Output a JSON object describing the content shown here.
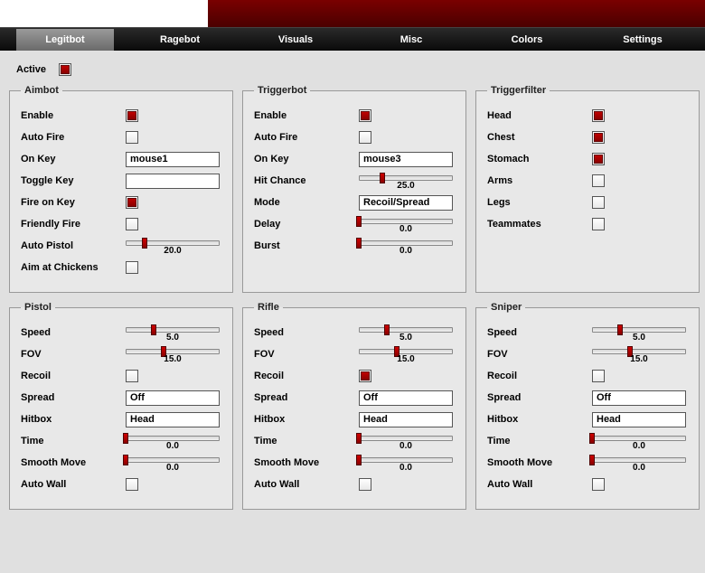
{
  "tabs": [
    "Legitbot",
    "Ragebot",
    "Visuals",
    "Misc",
    "Colors",
    "Settings"
  ],
  "active_tab": "Legitbot",
  "top": {
    "active_label": "Active",
    "active_checked": true
  },
  "panels": {
    "aimbot": {
      "title": "Aimbot",
      "enable_label": "Enable",
      "enable_checked": true,
      "autofire_label": "Auto Fire",
      "autofire_checked": false,
      "onkey_label": "On Key",
      "onkey_value": "mouse1",
      "togglekey_label": "Toggle Key",
      "togglekey_value": "",
      "fireonkey_label": "Fire on Key",
      "fireonkey_checked": true,
      "friendlyfire_label": "Friendly Fire",
      "friendlyfire_checked": false,
      "autopistol_label": "Auto Pistol",
      "autopistol_value": "20.0",
      "autopistol_pct": 20,
      "aimchickens_label": "Aim at Chickens",
      "aimchickens_checked": false
    },
    "triggerbot": {
      "title": "Triggerbot",
      "enable_label": "Enable",
      "enable_checked": true,
      "autofire_label": "Auto Fire",
      "autofire_checked": false,
      "onkey_label": "On Key",
      "onkey_value": "mouse3",
      "hitchance_label": "Hit Chance",
      "hitchance_value": "25.0",
      "hitchance_pct": 25,
      "mode_label": "Mode",
      "mode_value": "Recoil/Spread",
      "delay_label": "Delay",
      "delay_value": "0.0",
      "delay_pct": 0,
      "burst_label": "Burst",
      "burst_value": "0.0",
      "burst_pct": 0
    },
    "triggerfilter": {
      "title": "Triggerfilter",
      "head_label": "Head",
      "head_checked": true,
      "chest_label": "Chest",
      "chest_checked": true,
      "stomach_label": "Stomach",
      "stomach_checked": true,
      "arms_label": "Arms",
      "arms_checked": false,
      "legs_label": "Legs",
      "legs_checked": false,
      "teammates_label": "Teammates",
      "teammates_checked": false
    },
    "pistol": {
      "title": "Pistol",
      "speed_label": "Speed",
      "speed_value": "5.0",
      "speed_pct": 30,
      "fov_label": "FOV",
      "fov_value": "15.0",
      "fov_pct": 40,
      "recoil_label": "Recoil",
      "recoil_checked": false,
      "spread_label": "Spread",
      "spread_value": "Off",
      "hitbox_label": "Hitbox",
      "hitbox_value": "Head",
      "time_label": "Time",
      "time_value": "0.0",
      "time_pct": 0,
      "smooth_label": "Smooth Move",
      "smooth_value": "0.0",
      "smooth_pct": 0,
      "autowall_label": "Auto Wall",
      "autowall_checked": false
    },
    "rifle": {
      "title": "Rifle",
      "speed_label": "Speed",
      "speed_value": "5.0",
      "speed_pct": 30,
      "fov_label": "FOV",
      "fov_value": "15.0",
      "fov_pct": 40,
      "recoil_label": "Recoil",
      "recoil_checked": true,
      "spread_label": "Spread",
      "spread_value": "Off",
      "hitbox_label": "Hitbox",
      "hitbox_value": "Head",
      "time_label": "Time",
      "time_value": "0.0",
      "time_pct": 0,
      "smooth_label": "Smooth Move",
      "smooth_value": "0.0",
      "smooth_pct": 0,
      "autowall_label": "Auto Wall",
      "autowall_checked": false
    },
    "sniper": {
      "title": "Sniper",
      "speed_label": "Speed",
      "speed_value": "5.0",
      "speed_pct": 30,
      "fov_label": "FOV",
      "fov_value": "15.0",
      "fov_pct": 40,
      "recoil_label": "Recoil",
      "recoil_checked": false,
      "spread_label": "Spread",
      "spread_value": "Off",
      "hitbox_label": "Hitbox",
      "hitbox_value": "Head",
      "time_label": "Time",
      "time_value": "0.0",
      "time_pct": 0,
      "smooth_label": "Smooth Move",
      "smooth_value": "0.0",
      "smooth_pct": 0,
      "autowall_label": "Auto Wall",
      "autowall_checked": false
    }
  }
}
